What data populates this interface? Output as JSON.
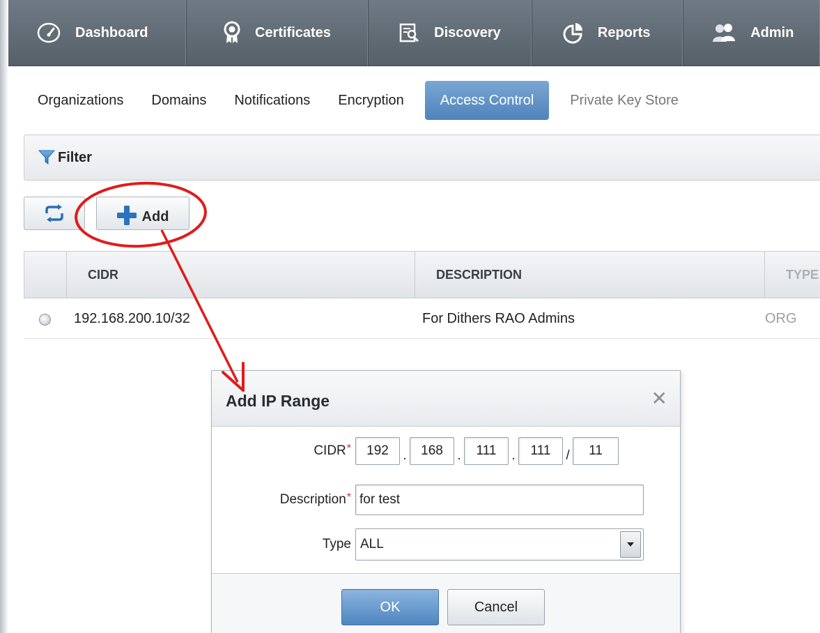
{
  "topnav": {
    "tabs": [
      {
        "label": "Dashboard",
        "icon": "speedometer-icon"
      },
      {
        "label": "Certificates",
        "icon": "certificate-ribbon-icon"
      },
      {
        "label": "Discovery",
        "icon": "discovery-search-icon"
      },
      {
        "label": "Reports",
        "icon": "pie-chart-icon"
      },
      {
        "label": "Admin",
        "icon": "users-icon"
      }
    ]
  },
  "subnav": {
    "items": [
      {
        "label": "Organizations",
        "state": "normal"
      },
      {
        "label": "Domains",
        "state": "normal"
      },
      {
        "label": "Notifications",
        "state": "normal"
      },
      {
        "label": "Encryption",
        "state": "normal"
      },
      {
        "label": "Access Control",
        "state": "active"
      },
      {
        "label": "Private Key Store",
        "state": "disabled"
      }
    ]
  },
  "filter": {
    "label": "Filter",
    "icon": "funnel-icon"
  },
  "toolbar": {
    "refresh_icon": "refresh-icon",
    "add_label": "Add",
    "add_icon": "plus-icon"
  },
  "table": {
    "columns": [
      "CIDR",
      "DESCRIPTION",
      "TYPE"
    ],
    "rows": [
      {
        "cidr": "192.168.200.10/32",
        "description": "For Dithers RAO Admins",
        "type": "ORG"
      }
    ]
  },
  "dialog": {
    "title": "Add IP Range",
    "cidr_label": "CIDR",
    "required_mark": "*",
    "cidr": {
      "oct1": "192",
      "oct2": "168",
      "oct3": "111",
      "oct4": "111",
      "mask": "11",
      "dot": ".",
      "slash": "/"
    },
    "description_label": "Description",
    "description_value": "for test",
    "type_label": "Type",
    "type_value": "ALL",
    "ok_label": "OK",
    "cancel_label": "Cancel",
    "close_glyph": "✕"
  },
  "colors": {
    "nav_bg": "#5f6a73",
    "active_tab": "#5d8ec4",
    "annotation": "#e01b1b",
    "required": "#d12b2b"
  }
}
